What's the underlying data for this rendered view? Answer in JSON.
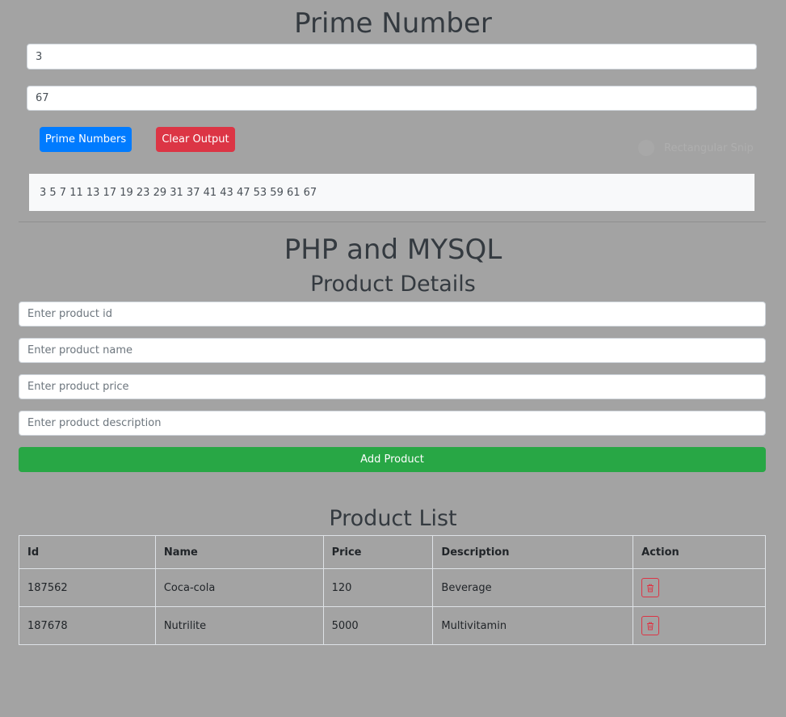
{
  "prime": {
    "title": "Prime Number",
    "start_value": "3",
    "end_value": "67",
    "prime_button": "Prime Numbers",
    "clear_button": "Clear Output",
    "output": "3 5 7 11 13 17 19 23 29 31 37 41 43 47 53 59 61 67"
  },
  "overlay": {
    "ghost_label": "Rectangular Snip"
  },
  "php": {
    "title": "PHP and MYSQL",
    "details_title": "Product Details",
    "id_placeholder": "Enter product id",
    "name_placeholder": "Enter product name",
    "price_placeholder": "Enter product price",
    "description_placeholder": "Enter product description",
    "add_button": "Add Product"
  },
  "product_list": {
    "title": "Product List",
    "headers": [
      "Id",
      "Name",
      "Price",
      "Description",
      "Action"
    ],
    "rows": [
      {
        "id": "187562",
        "name": "Coca-cola",
        "price": "120",
        "description": "Beverage"
      },
      {
        "id": "187678",
        "name": "Nutrilite",
        "price": "5000",
        "description": "Multivitamin"
      }
    ]
  },
  "colors": {
    "background": "#a3a3a3",
    "primary": "#007bff",
    "danger": "#dc3545",
    "success": "#28a745"
  },
  "icons": {
    "delete": "trash-icon"
  }
}
